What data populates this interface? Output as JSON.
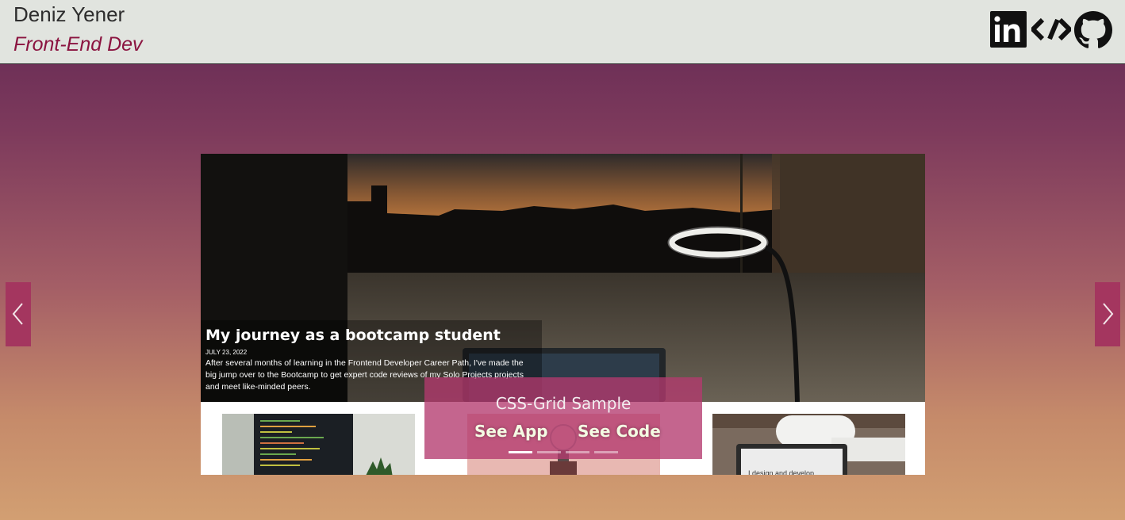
{
  "header": {
    "name": "Deniz Yener",
    "role": "Front-End Dev",
    "social": [
      {
        "icon": "linkedin-icon"
      },
      {
        "icon": "scrimba-icon"
      },
      {
        "icon": "github-icon"
      }
    ]
  },
  "slide": {
    "post_title": "My journey as a bootcamp student",
    "post_date": "JULY 23, 2022",
    "post_excerpt": "After several months of learning in the Frontend Developer Career Path, I've made the big jump over to the Bootcamp to get expert code reviews of my Solo Projects projects and meet like-minded peers.",
    "caption_title": "CSS-Grid Sample",
    "see_app_label": "See App",
    "see_code_label": "See Code",
    "indicator_count": 4,
    "active_indicator": 1
  },
  "controls": {
    "prev_icon": "chevron-left-icon",
    "next_icon": "chevron-right-icon"
  },
  "colors": {
    "header_bg": "#e1e4df",
    "role_text": "#8b1440",
    "overlay_bg": "#b43a6e",
    "arrow_bg": "#a4365f",
    "bg_gradient_top": "#612753",
    "bg_gradient_bottom": "#d29f72"
  }
}
